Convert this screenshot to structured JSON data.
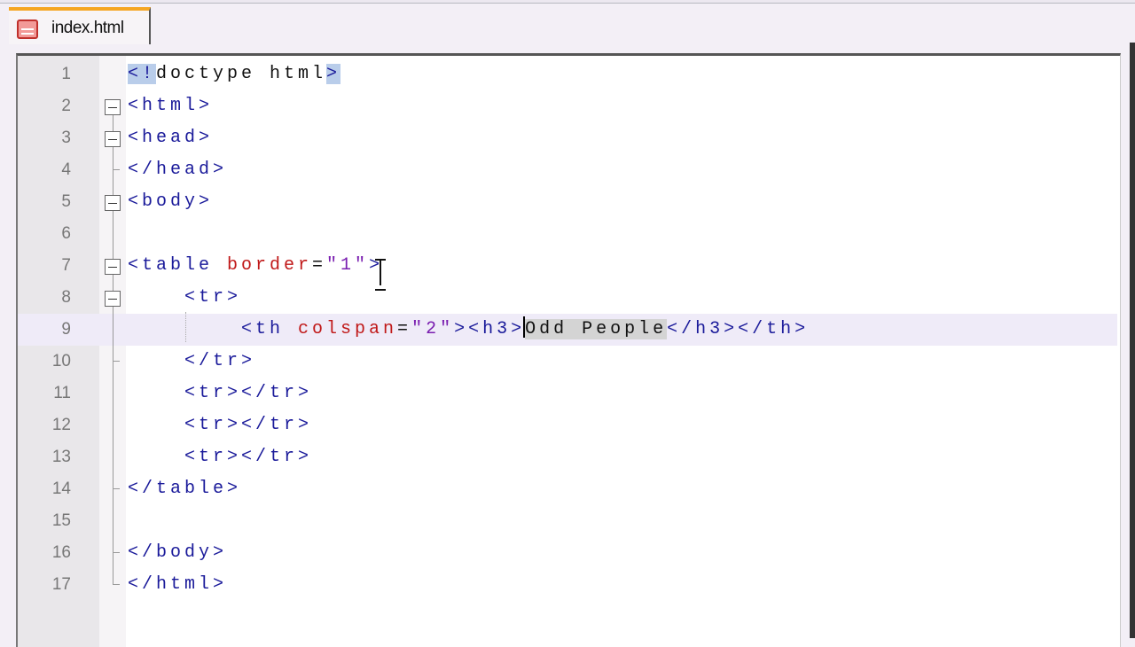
{
  "tab": {
    "title": "index.html",
    "icon": "html-file-icon"
  },
  "colors": {
    "tag": "#1a1a9a",
    "attr": "#c01818",
    "value": "#7a1eb0",
    "current_line": "#efebf8",
    "tab_accent": "#f5a623"
  },
  "editor": {
    "current_line": 9,
    "lines": [
      {
        "n": "1",
        "fold": "",
        "tokens": [
          [
            "<!",
            "tag match"
          ],
          [
            "doctype html",
            "text"
          ],
          [
            ">",
            "tag match"
          ]
        ]
      },
      {
        "n": "2",
        "fold": "box",
        "tokens": [
          [
            "<html>",
            "tag"
          ]
        ]
      },
      {
        "n": "3",
        "fold": "box",
        "tokens": [
          [
            "<head>",
            "tag"
          ]
        ]
      },
      {
        "n": "4",
        "fold": "end",
        "tokens": [
          [
            "</head>",
            "tag"
          ]
        ]
      },
      {
        "n": "5",
        "fold": "box",
        "tokens": [
          [
            "<body>",
            "tag"
          ]
        ]
      },
      {
        "n": "6",
        "fold": "line",
        "tokens": []
      },
      {
        "n": "7",
        "fold": "box",
        "tokens": [
          [
            "<table ",
            "tag"
          ],
          [
            "border",
            "attr"
          ],
          [
            "=",
            "text"
          ],
          [
            "\"1\"",
            "val"
          ],
          [
            ">",
            "tag"
          ]
        ]
      },
      {
        "n": "8",
        "fold": "box",
        "tokens": [
          [
            "    ",
            "text"
          ],
          [
            "<tr>",
            "tag"
          ]
        ]
      },
      {
        "n": "9",
        "fold": "line",
        "tokens": [
          [
            "        ",
            "text"
          ],
          [
            "<th ",
            "tag"
          ],
          [
            "colspan",
            "attr"
          ],
          [
            "=",
            "text"
          ],
          [
            "\"2\"",
            "val"
          ],
          [
            "><h3>",
            "tag"
          ],
          [
            "Odd People",
            "text sel"
          ],
          [
            "</h3></th>",
            "tag"
          ]
        ]
      },
      {
        "n": "10",
        "fold": "end",
        "tokens": [
          [
            "    ",
            "text"
          ],
          [
            "</tr>",
            "tag"
          ]
        ]
      },
      {
        "n": "11",
        "fold": "line",
        "tokens": [
          [
            "    ",
            "text"
          ],
          [
            "<tr></tr>",
            "tag"
          ]
        ]
      },
      {
        "n": "12",
        "fold": "line",
        "tokens": [
          [
            "    ",
            "text"
          ],
          [
            "<tr></tr>",
            "tag"
          ]
        ]
      },
      {
        "n": "13",
        "fold": "line",
        "tokens": [
          [
            "    ",
            "text"
          ],
          [
            "<tr></tr>",
            "tag"
          ]
        ]
      },
      {
        "n": "14",
        "fold": "end",
        "tokens": [
          [
            "</table>",
            "tag"
          ]
        ]
      },
      {
        "n": "15",
        "fold": "line",
        "tokens": []
      },
      {
        "n": "16",
        "fold": "end",
        "tokens": [
          [
            "</body>",
            "tag"
          ]
        ]
      },
      {
        "n": "17",
        "fold": "end",
        "tokens": [
          [
            "</html>",
            "tag"
          ]
        ]
      }
    ]
  }
}
